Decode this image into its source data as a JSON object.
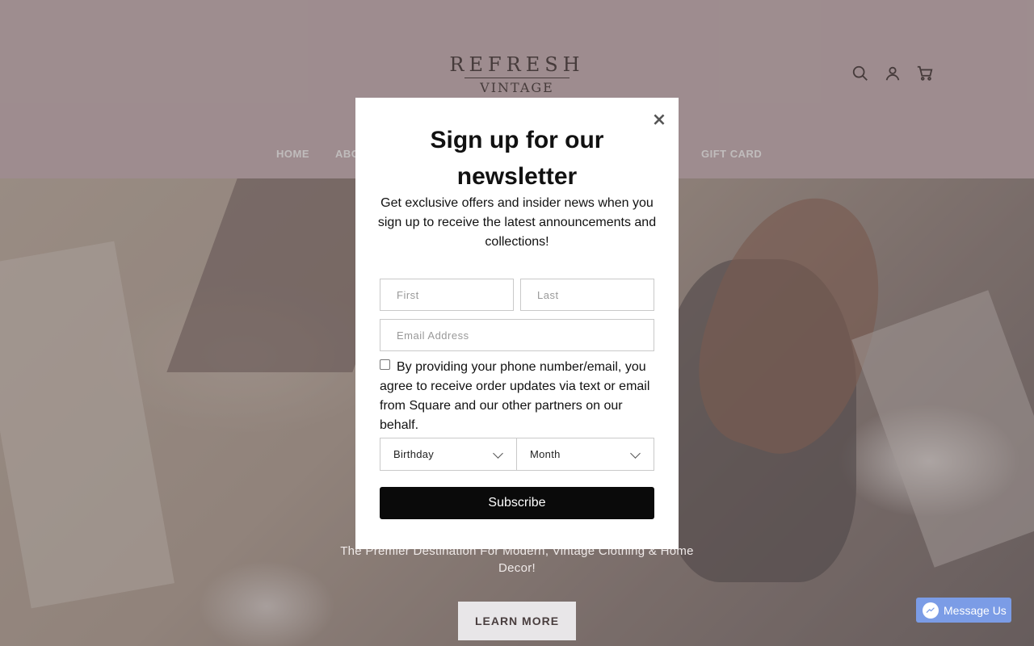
{
  "header": {
    "logo_line1": "REFRESH",
    "logo_line2": "VINTAGE",
    "icons": [
      "search-icon",
      "account-icon",
      "cart-icon"
    ],
    "nav": {
      "home": "HOME",
      "about": "ABO",
      "gift_card": "GIFT CARD"
    }
  },
  "hero": {
    "tagline": "The Premier Destination For Modern, Vintage Clothing & Home Decor!",
    "button": "LEARN MORE"
  },
  "messenger": {
    "label": "Message Us",
    "color": "#7b9ce6"
  },
  "modal": {
    "close": "×",
    "title": "Sign up for our newsletter",
    "subtitle": "Get exclusive offers and insider news when you sign up to receive the latest announcements and collections!",
    "first_placeholder": "First",
    "last_placeholder": "Last",
    "email_placeholder": "Email Address",
    "consent": "By providing your phone number/email, you agree to receive order updates via text or email from Square and our other partners on our behalf.",
    "consent_checked": false,
    "birthday_select": "Birthday",
    "month_select": "Month",
    "subscribe": "Subscribe"
  }
}
